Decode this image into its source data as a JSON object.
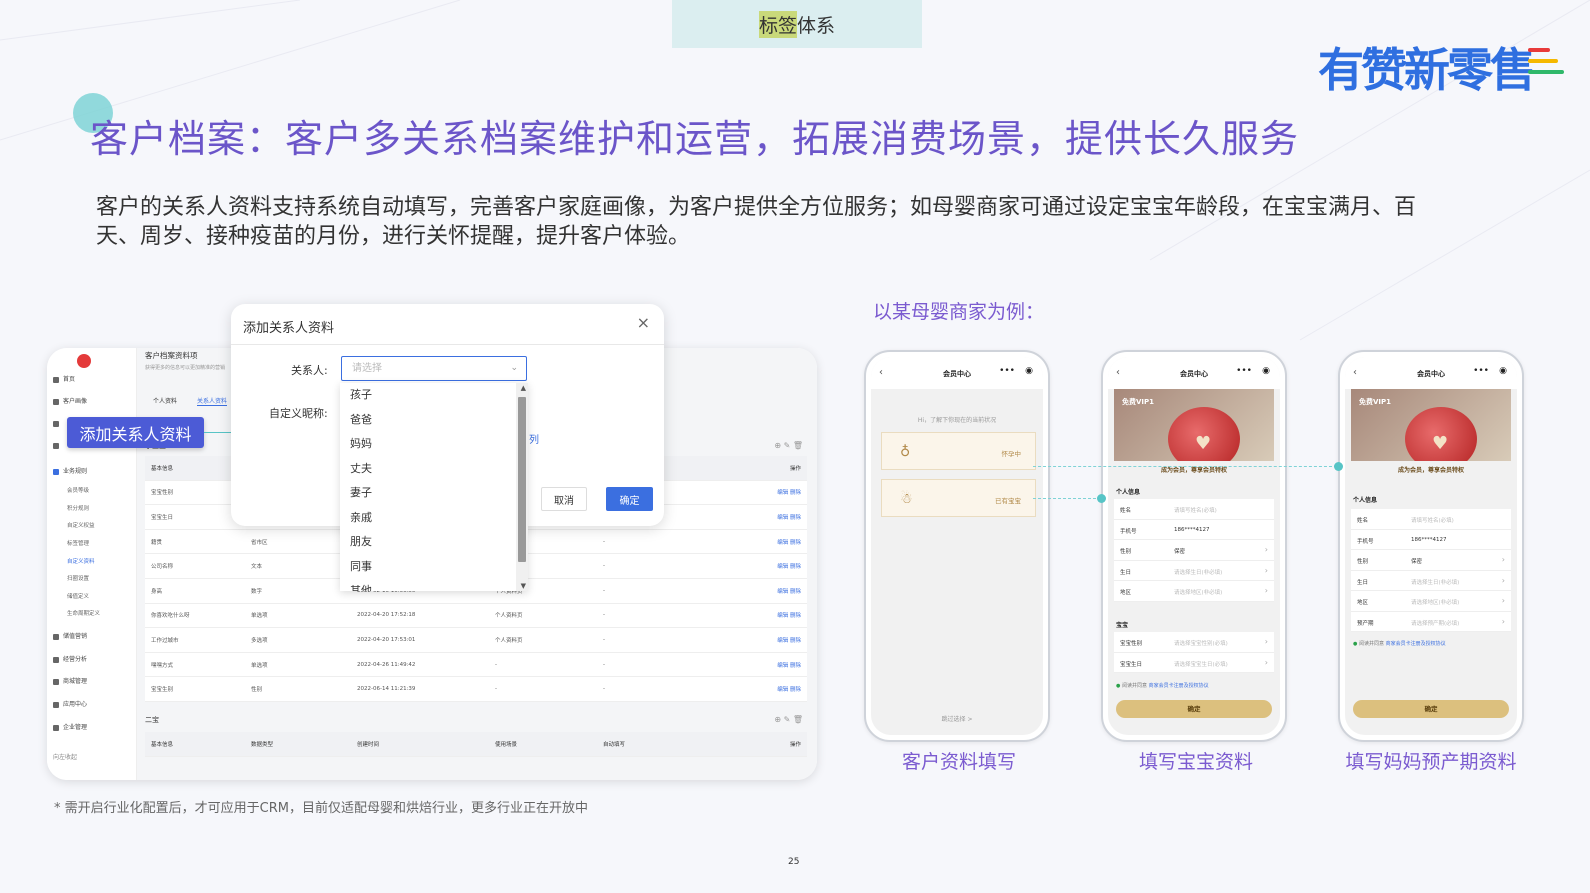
{
  "top_tab": {
    "highlight": "标签",
    "rest": "体系"
  },
  "brand": {
    "logo_text": "有赞新零售",
    "bar_colors": [
      "#e83a3a",
      "#f5b800",
      "#2fb86a"
    ]
  },
  "title": "客户档案：客户多关系档案维护和运营，拓展消费场景，提供长久服务",
  "description": "客户的关系人资料支持系统自动填写，完善客户家庭画像，为客户提供全方位服务；如母婴商家可通过设定宝宝年龄段，在宝宝满月、百天、周岁、接种疫苗的月份，进行关怀提醒，提升客户体验。",
  "example_label": "以某母婴商家为例：",
  "admin": {
    "sidebar": [
      {
        "icon": "home-icon",
        "label": "首页"
      },
      {
        "icon": "customer-icon",
        "label": "客户画像"
      },
      {
        "icon": "user-icon",
        "label": ""
      },
      {
        "icon": "grid-icon",
        "label": ""
      },
      {
        "icon": "business-icon",
        "label": "业务规则"
      }
    ],
    "sidebar_sub": [
      "会员等级",
      "积分规则",
      "自定义权益",
      "标签管理",
      "自定义资料",
      "扫圈设置",
      "储值定义",
      "生命周期定义"
    ],
    "sidebar_more": [
      "储值营销",
      "经营分析",
      "商城管理",
      "应用中心",
      "企业管理"
    ],
    "sidebar_footer": "向左收起",
    "breadcrumb": "客户档案资料项",
    "breadcrumb_sub": "获得更多的信息可以更加精准的营销",
    "tabs": [
      "个人资料",
      "关系人资料"
    ],
    "section1": "小宝宝",
    "section2": "二宝",
    "headers": [
      "基本信息",
      "",
      "",
      "",
      "",
      "操作"
    ],
    "headers2": [
      "基本信息",
      "数据类型",
      "创建时间",
      "使用场景",
      "自动填写",
      "操作"
    ],
    "rows": [
      {
        "c1": "宝宝性别",
        "c2": "",
        "c3": "",
        "c4": "",
        "c5": "",
        "c6": "编辑 删除"
      },
      {
        "c1": "宝宝生日",
        "c2": "日期",
        "c3": "",
        "c4": "",
        "c5": "",
        "c6": "编辑 删除"
      },
      {
        "c1": "籍贯",
        "c2": "省市区",
        "c3": "",
        "c4": "",
        "c5": "-",
        "c6": "编辑 删除"
      },
      {
        "c1": "公司名称",
        "c2": "文本",
        "c3": "",
        "c4": "",
        "c5": "-",
        "c6": "编辑 删除"
      },
      {
        "c1": "身高",
        "c2": "数字",
        "c3": "2022-02-10 10:56:50",
        "c4": "个人资料页",
        "c5": "-",
        "c6": "编辑 删除"
      },
      {
        "c1": "你喜欢吃什么呀",
        "c2": "单选项",
        "c3": "2022-04-20 17:52:18",
        "c4": "个人资料页",
        "c5": "-",
        "c6": "编辑 删除"
      },
      {
        "c1": "工作过城市",
        "c2": "多选项",
        "c3": "2022-04-20 17:53:01",
        "c4": "个人资料页",
        "c5": "-",
        "c6": "编辑 删除"
      },
      {
        "c1": "嘿嘿方式",
        "c2": "单选项",
        "c3": "2022-04-26 11:49:42",
        "c4": "-",
        "c5": "-",
        "c6": "编辑 删除"
      },
      {
        "c1": "宝宝生别",
        "c2": "性别",
        "c3": "2022-06-14 11:21:39",
        "c4": "-",
        "c5": "-",
        "c6": "编辑 删除"
      }
    ]
  },
  "callout": "添加关系人资料",
  "modal": {
    "title": "添加关系人资料",
    "label_relation": "关系人:",
    "label_nickname": "自定义昵称:",
    "select_placeholder": "请选择",
    "link": "列",
    "cancel": "取消",
    "confirm": "确定",
    "options": [
      "孩子",
      "爸爸",
      "妈妈",
      "丈夫",
      "妻子",
      "亲戚",
      "朋友",
      "同事",
      "其他"
    ]
  },
  "phones": [
    {
      "title": "会员中心",
      "hint": "Hi，了解下你现在的当前状况",
      "cards": [
        "怀孕中",
        "已有宝宝"
      ],
      "skip": "跳过选择 >",
      "caption": "客户资料填写"
    },
    {
      "title": "会员中心",
      "vip": "免费VIP1",
      "vip_text": "成为会员，尊享会员特权",
      "section_personal": "个人信息",
      "fields": [
        {
          "k": "姓名",
          "v": "请填写姓名(必填)",
          "filled": false,
          "chev": false
        },
        {
          "k": "手机号",
          "v": "186****4127",
          "filled": true,
          "chev": false
        },
        {
          "k": "性别",
          "v": "保密",
          "filled": true,
          "chev": true
        },
        {
          "k": "生日",
          "v": "请选择生日(非必填)",
          "filled": false,
          "chev": true
        },
        {
          "k": "地区",
          "v": "请选择地区(非必填)",
          "filled": false,
          "chev": true
        }
      ],
      "section_baby": "宝宝",
      "baby_fields": [
        {
          "k": "宝宝性别",
          "v": "请选择宝宝性别(必填)"
        },
        {
          "k": "宝宝生日",
          "v": "请选择宝宝生日(必填)"
        }
      ],
      "agree": "阅读并同意",
      "agree_link": "商家会员卡注册及授权协议",
      "button": "确定",
      "caption": "填写宝宝资料"
    },
    {
      "title": "会员中心",
      "vip": "免费VIP1",
      "vip_text": "成为会员，尊享会员特权",
      "section_personal": "个人信息",
      "fields": [
        {
          "k": "姓名",
          "v": "请填写姓名(必填)",
          "filled": false,
          "chev": false
        },
        {
          "k": "手机号",
          "v": "186****4127",
          "filled": true,
          "chev": false
        },
        {
          "k": "性别",
          "v": "保密",
          "filled": true,
          "chev": true
        },
        {
          "k": "生日",
          "v": "请选择生日(非必填)",
          "filled": false,
          "chev": true
        },
        {
          "k": "地区",
          "v": "请选择地区(非必填)",
          "filled": false,
          "chev": true
        },
        {
          "k": "预产期",
          "v": "请选择预产期(必填)",
          "filled": false,
          "chev": true
        }
      ],
      "agree": "阅读并同意",
      "agree_link": "商家会员卡注册及授权协议",
      "button": "确定",
      "caption": "填写妈妈预产期资料"
    }
  ],
  "footnote": "* 需开启行业化配置后，才可应用于CRM，目前仅适配母婴和烘焙行业，更多行业正在开放中",
  "page_number": "25"
}
